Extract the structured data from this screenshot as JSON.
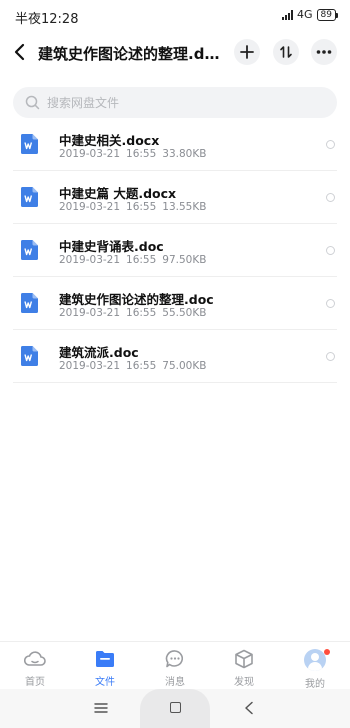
{
  "status_bar": {
    "time": "半夜12:28",
    "network": "4G",
    "battery": "89"
  },
  "header": {
    "title": "建筑史作图论述的整理.docx",
    "back_icon": "chevron-left-icon",
    "add_icon": "plus-icon",
    "sort_icon": "sort-arrows-icon",
    "more_icon": "more-dots-icon"
  },
  "search": {
    "placeholder": "搜索网盘文件",
    "value": ""
  },
  "files": [
    {
      "name": "中建史相关.docx",
      "date": "2019-03-21",
      "time": "16:55",
      "size": "33.80KB"
    },
    {
      "name": "中建史篇 大题.docx",
      "date": "2019-03-21",
      "time": "16:55",
      "size": "13.55KB"
    },
    {
      "name": "中建史背诵表.doc",
      "date": "2019-03-21",
      "time": "16:55",
      "size": "97.50KB"
    },
    {
      "name": "建筑史作图论述的整理.doc",
      "date": "2019-03-21",
      "time": "16:55",
      "size": "55.50KB"
    },
    {
      "name": "建筑流派.doc",
      "date": "2019-03-21",
      "time": "16:55",
      "size": "75.00KB"
    }
  ],
  "tabs": [
    {
      "label": "首页",
      "icon": "home-cloud-icon",
      "active": false
    },
    {
      "label": "文件",
      "icon": "folder-icon",
      "active": true
    },
    {
      "label": "消息",
      "icon": "chat-bubble-icon",
      "active": false
    },
    {
      "label": "发现",
      "icon": "cube-icon",
      "active": false
    },
    {
      "label": "我的",
      "icon": "avatar",
      "active": false
    }
  ],
  "colors": {
    "accent": "#3a7cf7",
    "word_icon": "#3f7fe6",
    "inactive_tab": "#9a9ca0",
    "notification_dot": "#ff4d3d"
  }
}
